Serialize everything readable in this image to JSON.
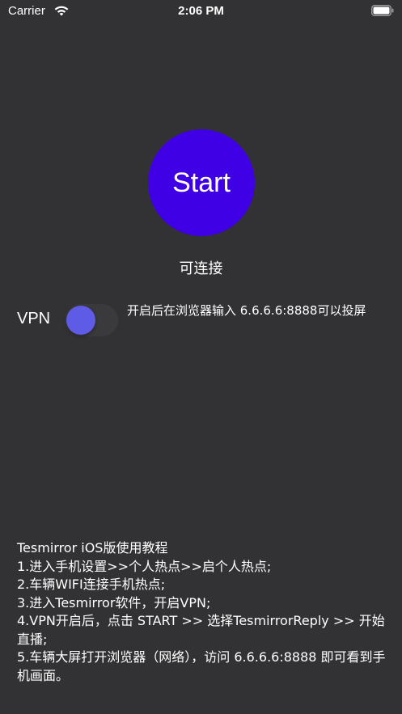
{
  "status_bar": {
    "carrier": "Carrier",
    "time": "2:06 PM",
    "wifi_icon": "wifi-icon",
    "battery_icon": "battery-full-icon"
  },
  "main": {
    "start_button_label": "Start",
    "start_button_color": "#3f00e6",
    "connection_status": "可连接"
  },
  "vpn": {
    "label": "VPN",
    "toggle_on": false,
    "toggle_knob_color": "#5e5ce6",
    "hint": "开启后在浏览器输入 6.6.6.6:8888可以投屏"
  },
  "tutorial": {
    "title": "Tesmirror iOS版使用教程",
    "steps": [
      "1.进入手机设置>>个人热点>>启个人热点;",
      "2.车辆WIFI连接手机热点;",
      "3.进入Tesmirror软件，开启VPN;",
      "4.VPN开启后，点击 START >> 选择TesmirrorReply >> 开始直播;",
      "5.车辆大屏打开浏览器（网络），访问 6.6.6.6:8888 即可看到手机画面。"
    ]
  }
}
